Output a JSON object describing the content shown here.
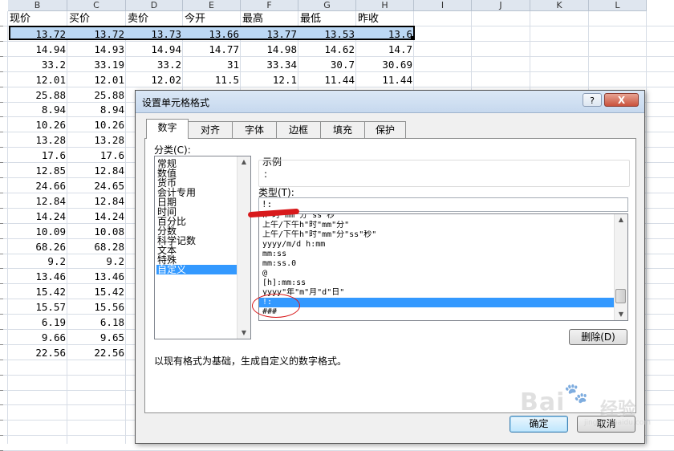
{
  "sheet": {
    "columns": [
      "B",
      "C",
      "D",
      "E",
      "F",
      "G",
      "H",
      "I",
      "J",
      "K",
      "L"
    ],
    "headers": [
      "现价",
      "买价",
      "卖价",
      "今开",
      "最高",
      "最低",
      "昨收"
    ],
    "rows": [
      [
        "13.72",
        "13.72",
        "13.73",
        "13.66",
        "13.77",
        "13.53",
        "13.6"
      ],
      [
        "14.94",
        "14.93",
        "14.94",
        "14.77",
        "14.98",
        "14.62",
        "14.7"
      ],
      [
        "33.2",
        "33.19",
        "33.2",
        "31",
        "33.34",
        "30.7",
        "30.69"
      ],
      [
        "12.01",
        "12.01",
        "12.02",
        "11.5",
        "12.1",
        "11.44",
        "11.44"
      ],
      [
        "25.88",
        "25.88",
        "",
        "",
        "",
        "",
        ""
      ],
      [
        "8.94",
        "8.94",
        "",
        "",
        "",
        "",
        ""
      ],
      [
        "10.26",
        "10.26",
        "",
        "",
        "",
        "",
        ""
      ],
      [
        "13.28",
        "13.28",
        "",
        "",
        "",
        "",
        ""
      ],
      [
        "17.6",
        "17.6",
        "",
        "",
        "",
        "",
        ""
      ],
      [
        "12.85",
        "12.84",
        "",
        "",
        "",
        "",
        ""
      ],
      [
        "24.66",
        "24.65",
        "",
        "",
        "",
        "",
        ""
      ],
      [
        "12.84",
        "12.84",
        "",
        "",
        "",
        "",
        ""
      ],
      [
        "14.24",
        "14.24",
        "",
        "",
        "",
        "",
        ""
      ],
      [
        "10.09",
        "10.08",
        "",
        "",
        "",
        "",
        ""
      ],
      [
        "68.26",
        "68.28",
        "",
        "",
        "",
        "",
        ""
      ],
      [
        "9.2",
        "9.2",
        "",
        "",
        "",
        "",
        ""
      ],
      [
        "13.46",
        "13.46",
        "",
        "",
        "",
        "",
        ""
      ],
      [
        "15.42",
        "15.42",
        "",
        "",
        "",
        "",
        ""
      ],
      [
        "15.57",
        "15.56",
        "",
        "",
        "",
        "",
        ""
      ],
      [
        "6.19",
        "6.18",
        "",
        "",
        "",
        "",
        ""
      ],
      [
        "9.66",
        "9.65",
        "",
        "",
        "",
        "",
        ""
      ],
      [
        "22.56",
        "22.56",
        "",
        "",
        "",
        "",
        ""
      ]
    ]
  },
  "dialog": {
    "title": "设置单元格格式",
    "help_label": "?",
    "close_label": "X",
    "tabs": [
      "数字",
      "对齐",
      "字体",
      "边框",
      "填充",
      "保护"
    ],
    "category_label": "分类(C):",
    "categories": [
      "常规",
      "数值",
      "货币",
      "会计专用",
      "日期",
      "时间",
      "百分比",
      "分数",
      "科学记数",
      "文本",
      "特殊",
      "自定义"
    ],
    "sample_label": "示例",
    "sample_value": ":",
    "type_label": "类型(T):",
    "type_value": "!:",
    "formats": [
      "h\"时\"mm\"分\"ss\"秒\"",
      "上午/下午h\"时\"mm\"分\"",
      "上午/下午h\"时\"mm\"分\"ss\"秒\"",
      "yyyy/m/d h:mm",
      "mm:ss",
      "mm:ss.0",
      "@",
      "[h]:mm:ss",
      "yyyy\"年\"m\"月\"d\"日\"",
      "!:",
      "###"
    ],
    "delete_label": "删除(D)",
    "description": "以现有格式为基础，生成自定义的数字格式。",
    "ok_label": "确定",
    "cancel_label": "取消"
  },
  "watermark": {
    "logo": "Bai",
    "brand": "经验",
    "url": "jingyan.baidu.com"
  }
}
